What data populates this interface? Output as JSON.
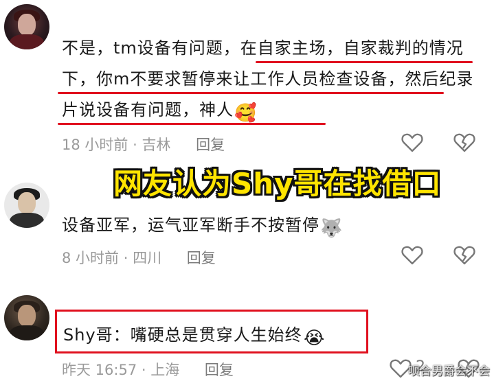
{
  "overlay": {
    "caption": "网友认为Shy哥在找借口",
    "watermark": "呗合男爵会不会"
  },
  "comments": [
    {
      "avatar": "anime-character-avatar",
      "text": "不是，tm设备有问题，在自家主场，自家裁判的情况下，你m不要求暂停来让工作人员检查设备，然后纪录片说设备有问题，神人",
      "emoji": "🥰",
      "time": "18 小时前",
      "location": "吉林",
      "reply_label": "回复"
    },
    {
      "avatar": "man-portrait-avatar",
      "text": "设备亚军，运气亚军断手不按暂停",
      "emoji": "🐺",
      "time": "8 小时前",
      "location": "四川",
      "reply_label": "回复"
    },
    {
      "avatar": "shy-avatar",
      "author": "Shy哥",
      "text": "Shy哥：嘴硬总是贯穿人生始终",
      "emoji": "😭",
      "time": "昨天 16:57",
      "location": "上海",
      "reply_label": "回复",
      "like_count": "2"
    }
  ],
  "colors": {
    "highlight_red": "#e0101e",
    "caption_yellow": "#ffe400",
    "meta_gray": "#9a9a9a"
  },
  "icons": [
    "heart-icon",
    "broken-heart-icon"
  ]
}
